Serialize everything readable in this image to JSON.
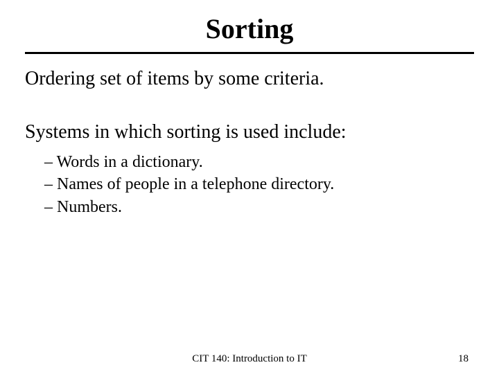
{
  "title": "Sorting",
  "para1": "Ordering set of items by some criteria.",
  "para2": "Systems in which sorting is used include:",
  "bullets": [
    "Words in a dictionary.",
    "Names of people in a telephone directory.",
    "Numbers."
  ],
  "footer": {
    "center": "CIT 140: Introduction to IT",
    "page": "18"
  }
}
